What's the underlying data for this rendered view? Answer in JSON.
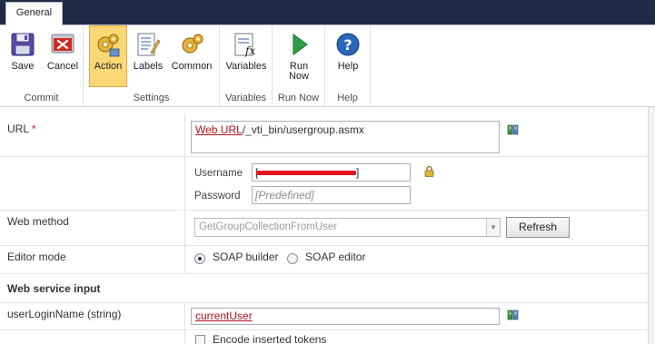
{
  "ribbon": {
    "tab_label": "General",
    "groups": {
      "commit": "Commit",
      "settings": "Settings",
      "variables": "Variables",
      "run_now": "Run Now",
      "help": "Help"
    },
    "buttons": {
      "save": "Save",
      "cancel": "Cancel",
      "action": "Action",
      "labels": "Labels",
      "common": "Common",
      "variables": "Variables",
      "run_now_line1": "Run",
      "run_now_line2": "Now",
      "help": "Help"
    },
    "selected_button": "Action",
    "icons": [
      "save-icon",
      "cancel-icon",
      "action-gear-icon",
      "labels-icon",
      "common-gear-icon",
      "variables-fx-icon",
      "run-play-icon",
      "help-question-icon"
    ]
  },
  "form": {
    "url": {
      "label": "URL",
      "required_mark": "*",
      "token": "Web URL",
      "suffix": "/_vti_bin/usergroup.asmx"
    },
    "credentials": {
      "username_label": "Username",
      "username_prefix": "[",
      "username_suffix": "]",
      "password_label": "Password",
      "password_placeholder": "[Predefined]"
    },
    "web_method": {
      "label": "Web method",
      "selected": "GetGroupCollectionFromUser",
      "refresh_label": "Refresh"
    },
    "editor_mode": {
      "label": "Editor mode",
      "option1": "SOAP builder",
      "option2": "SOAP editor",
      "selected": "SOAP builder"
    },
    "web_service_input": {
      "section_label": "Web service input",
      "param_label": "userLoginName (string)",
      "param_value_token": "currentUser"
    },
    "encode_tokens": {
      "label": "Encode inserted tokens",
      "checked": false
    }
  },
  "colors": {
    "ribbon_header": "#1f2b44",
    "selected_button": "#fbd875",
    "required": "#d7141a",
    "token": "#b5121b"
  }
}
